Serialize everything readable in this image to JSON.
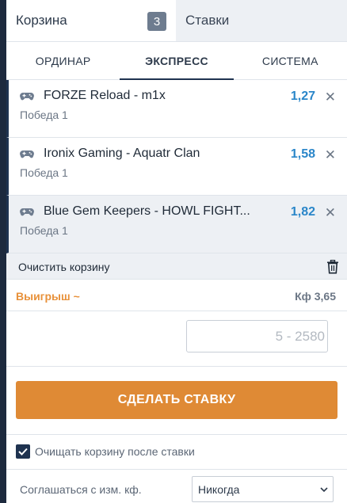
{
  "tabs": {
    "cart_label": "Корзина",
    "cart_count": "3",
    "bets_label": "Ставки"
  },
  "modes": [
    {
      "label": "ОРДИНАР"
    },
    {
      "label": "ЭКСПРЕСС"
    },
    {
      "label": "СИСТЕМА"
    }
  ],
  "bets": [
    {
      "teams": "FORZE Reload - m1x",
      "outcome": "Победа 1",
      "odd": "1,27",
      "icon": "gamepad-icon"
    },
    {
      "teams": "Ironix Gaming - Aquatr Clan",
      "outcome": "Победа 1",
      "odd": "1,58",
      "icon": "gamepad-icon"
    },
    {
      "teams": "Blue Gem Keepers - HOWL FIGHT...",
      "outcome": "Победа 1",
      "odd": "1,82",
      "icon": "gamepad-icon"
    }
  ],
  "clear": {
    "label": "Очистить корзину",
    "icon": "trash-icon"
  },
  "winnings": {
    "label": "Выигрыш ~",
    "coef": "Кф 3,65"
  },
  "stake": {
    "placeholder": "5 - 2580"
  },
  "place_bet": {
    "label": "СДЕЛАТЬ СТАВКУ"
  },
  "clear_after": {
    "label": "Очищать корзину после ставки",
    "checked": true
  },
  "agree": {
    "label": "Соглашаться с изм. кф.",
    "selected": "Никогда"
  },
  "colors": {
    "accent": "#df8a35",
    "odd": "#2a86c9",
    "navy": "#1f3350"
  }
}
